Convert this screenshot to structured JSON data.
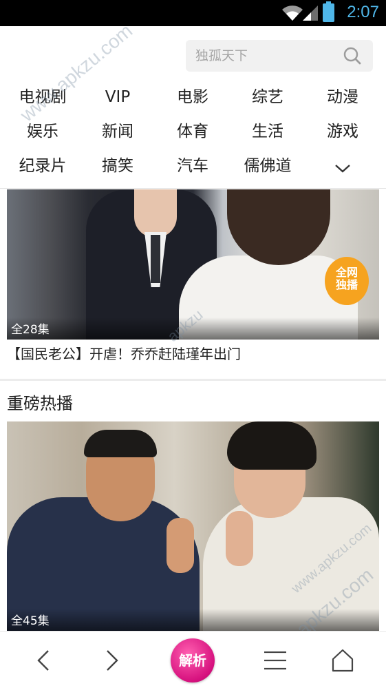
{
  "status_bar": {
    "time": "2:07"
  },
  "search": {
    "placeholder": "独孤天下"
  },
  "nav": {
    "items": [
      "电视剧",
      "VIP",
      "电影",
      "综艺",
      "动漫",
      "娱乐",
      "新闻",
      "体育",
      "生活",
      "游戏",
      "纪录片",
      "搞笑",
      "汽车",
      "儒佛道"
    ]
  },
  "cards": [
    {
      "episodes": "全28集",
      "badge": [
        "全网",
        "独播"
      ],
      "caption": "【国民老公】开虐！乔乔赶陆瑾年出门"
    },
    {
      "episodes": "全45集"
    }
  ],
  "section": {
    "title": "重磅热播"
  },
  "bottom_bar": {
    "parse_label": "解析"
  },
  "watermarks": [
    "www.apkzu.com",
    "apkzu",
    "www.apkzu.com",
    "www.apkzu.com"
  ]
}
